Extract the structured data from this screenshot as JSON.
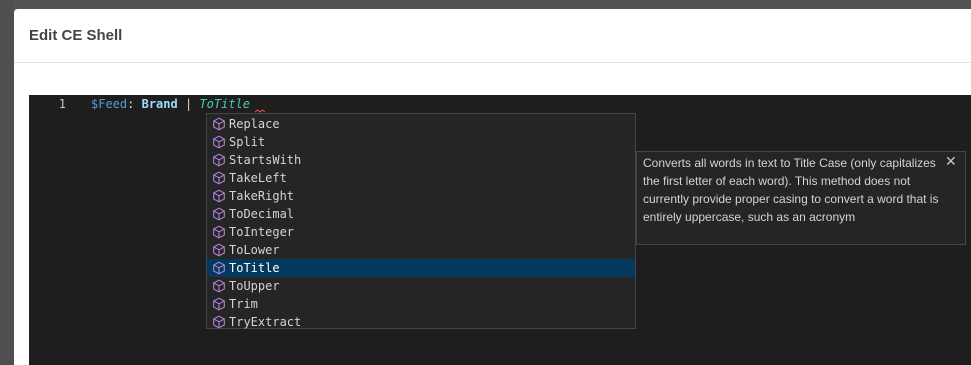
{
  "modal": {
    "title": "Edit CE Shell"
  },
  "editor": {
    "line_number": "1",
    "code": {
      "var": "$Feed",
      "colon": ":",
      "field": "Brand",
      "pipe": "|",
      "fn": "ToTitle"
    }
  },
  "suggestions": {
    "icon": "cube-icon",
    "selected_index": 8,
    "items": [
      "Replace",
      "Split",
      "StartsWith",
      "TakeLeft",
      "TakeRight",
      "ToDecimal",
      "ToInteger",
      "ToLower",
      "ToTitle",
      "ToUpper",
      "Trim",
      "TryExtract"
    ]
  },
  "doc": {
    "text": "Converts all words in text to Title Case (only capitalizes the first letter of each word). This method does not currently provide proper casing to convert a word that is entirely uppercase, such as an acronym",
    "close_icon": "close-icon"
  },
  "colors": {
    "editor_bg": "#1e1e1e",
    "suggest_bg": "#252526",
    "selected_bg": "#04395e",
    "icon_purple": "#b180d7"
  }
}
